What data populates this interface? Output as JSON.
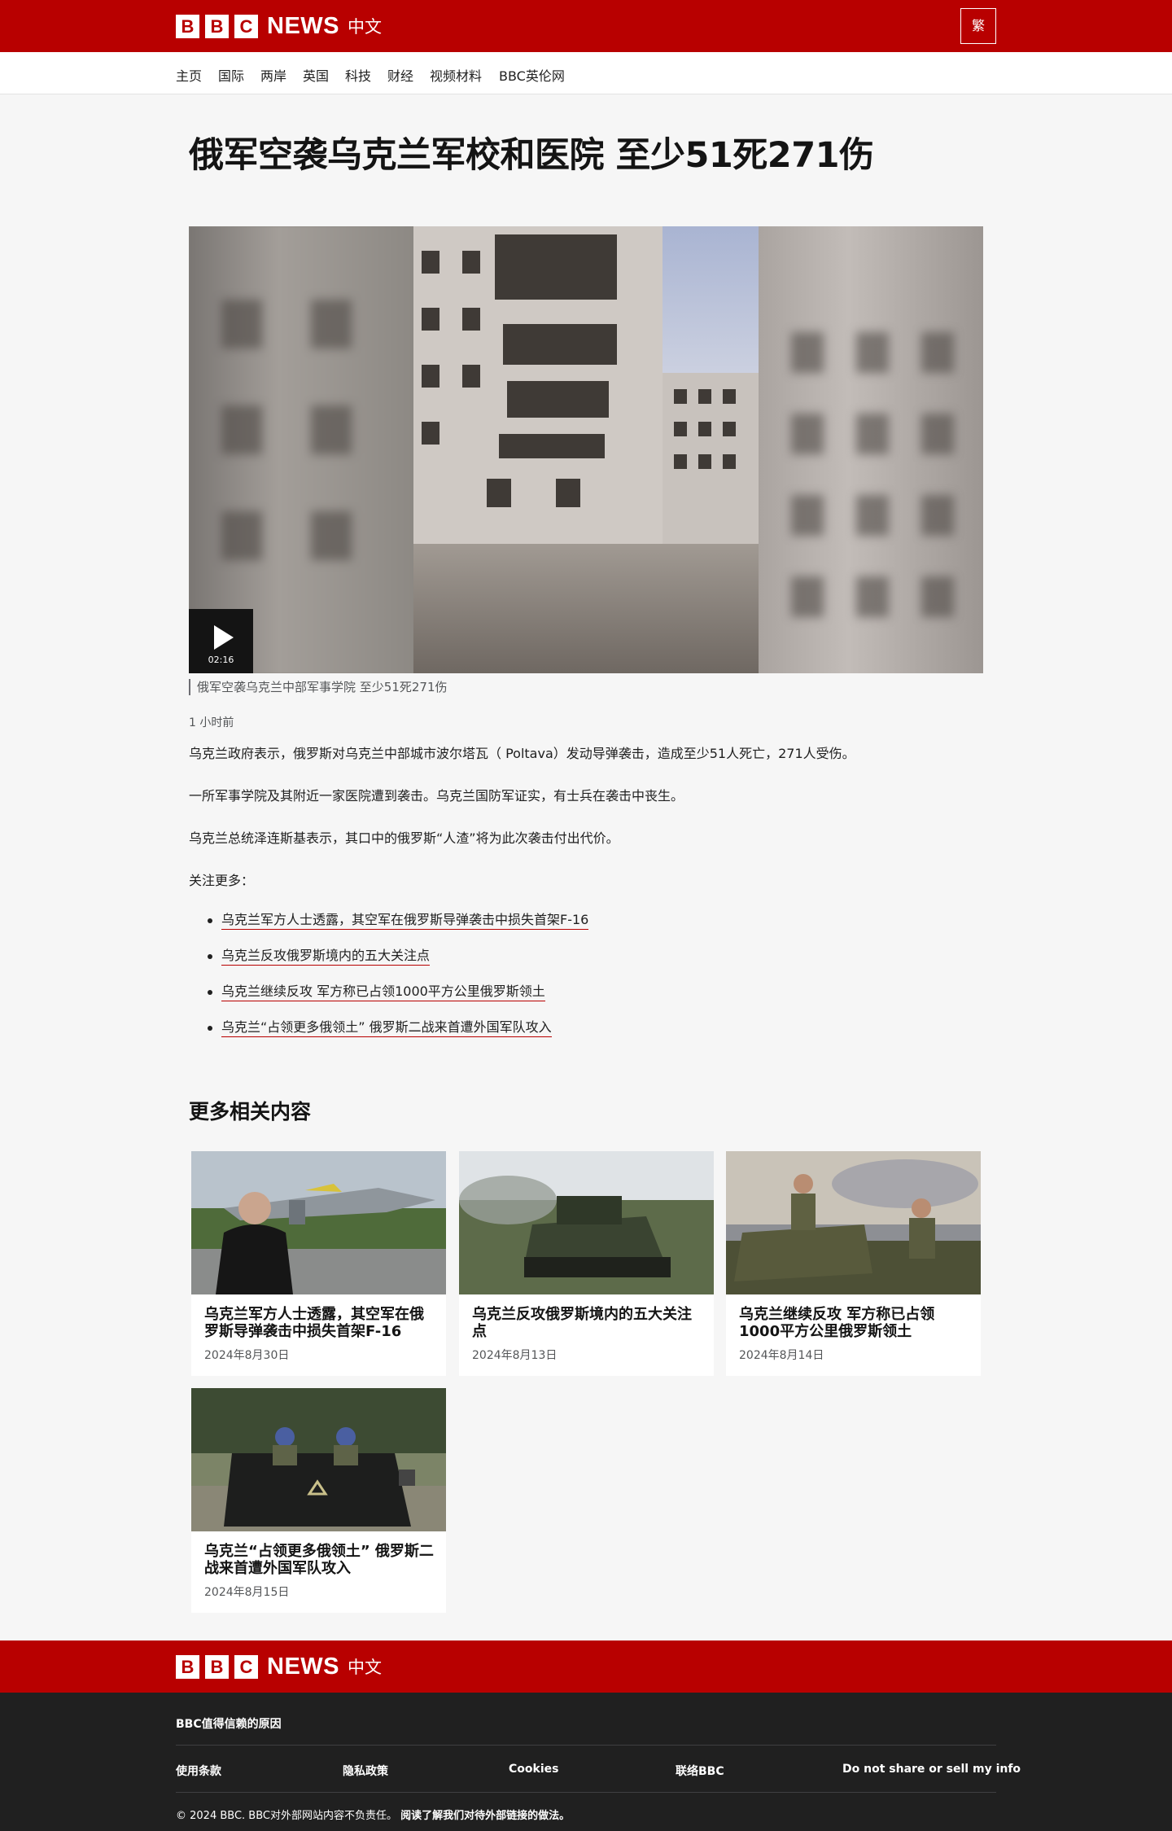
{
  "header": {
    "logo_letters": [
      "B",
      "B",
      "C"
    ],
    "logo_news": "NEWS",
    "logo_lang": "中文",
    "traditional_button": "繁"
  },
  "nav": {
    "items": [
      "主页",
      "国际",
      "两岸",
      "英国",
      "科技",
      "财经",
      "视频材料",
      "BBC英伦网"
    ]
  },
  "article": {
    "headline": "俄军空袭乌克兰军校和医院 至少51死271伤",
    "video": {
      "duration": "02:16",
      "caption": "俄军空袭乌克兰中部军事学院 至少51死271伤"
    },
    "timestamp": "1 小时前",
    "paragraphs": [
      "乌克兰政府表示，俄罗斯对乌克兰中部城市波尔塔瓦（ Poltava）发动导弹袭击，造成至少51人死亡，271人受伤。",
      "一所军事学院及其附近一家医院遭到袭击。乌克兰国防军证实，有士兵在袭击中丧生。",
      "乌克兰总统泽连斯基表示，其口中的俄罗斯“人渣”将为此次袭击付出代价。",
      "关注更多："
    ],
    "links": [
      "乌克兰军方人士透露，其空军在俄罗斯导弹袭击中损失首架F-16",
      "乌克兰反攻俄罗斯境内的五大关注点",
      "乌克兰继续反攻 军方称已占领1000平方公里俄罗斯领土",
      "乌克兰“占领更多俄领土” 俄罗斯二战来首遭外国军队攻入"
    ]
  },
  "related": {
    "title": "更多相关内容",
    "cards": [
      {
        "title": "乌克兰军方人士透露，其空军在俄罗斯导弹袭击中损失首架F-16",
        "date": "2024年8月30日"
      },
      {
        "title": "乌克兰反攻俄罗斯境内的五大关注点",
        "date": "2024年8月13日"
      },
      {
        "title": "乌克兰继续反攻 军方称已占领1000平方公里俄罗斯领土",
        "date": "2024年8月14日"
      },
      {
        "title": "乌克兰“占领更多俄领土” 俄罗斯二战来首遭外国军队攻入",
        "date": "2024年8月15日"
      }
    ]
  },
  "footer": {
    "trust": "BBC值得信赖的原因",
    "links": [
      "使用条款",
      "隐私政策",
      "Cookies",
      "联络BBC",
      "Do not share or sell my info"
    ],
    "copyright": "© 2024 BBC. BBC对外部网站内容不负责任。",
    "external_link_policy": "阅读了解我们对待外部链接的做法。"
  },
  "colors": {
    "brand_red": "#b80000",
    "footer_dark": "#202020",
    "page_bg": "#f6f6f6"
  }
}
